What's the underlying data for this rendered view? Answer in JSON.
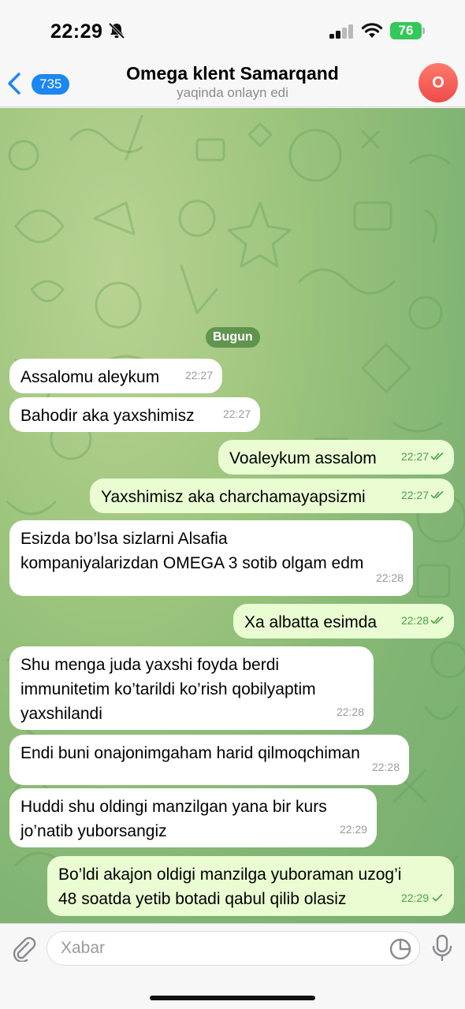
{
  "status": {
    "time": "22:29",
    "battery": "76"
  },
  "header": {
    "back_count": "735",
    "title": "Omega klent Samarqand",
    "subtitle": "yaqinda onlayn edi",
    "avatar_letter": "O"
  },
  "date_label": "Bugun",
  "messages": [
    {
      "dir": "in",
      "text": "Assalomu aleykum",
      "time": "22:27"
    },
    {
      "dir": "in",
      "text": "Bahodir aka yaxshimisz",
      "time": "22:27"
    },
    {
      "dir": "out",
      "text": "Voaleykum assalom",
      "time": "22:27",
      "status": "read"
    },
    {
      "dir": "out",
      "text": "Yaxshimisz aka charchamayapsizmi",
      "time": "22:27",
      "status": "read"
    },
    {
      "dir": "in",
      "text": "Esizda bo’lsa sizlarni Alsafia\nkompaniyalarizdan OMEGA 3 sotib olgam edm",
      "time": "22:28"
    },
    {
      "dir": "out",
      "text": "Xa albatta esimda",
      "time": "22:28",
      "status": "read"
    },
    {
      "dir": "in",
      "text": "Shu menga juda yaxshi foyda berdi\nimmunitetim ko’tarildi ko’rish qobilyaptim\nyaxshilandi",
      "time": "22:28"
    },
    {
      "dir": "in",
      "text": "Endi buni onajonimgaham harid qilmoqchiman",
      "time": "22:28"
    },
    {
      "dir": "in",
      "text": "Huddi shu oldingi manzilgan yana bir kurs\njo’natib yuborsangiz",
      "time": "22:29"
    },
    {
      "dir": "out",
      "text": "Bo’ldi akajon oldigi manzilga yuboraman uzog’i\n48 soatda yetib botadi qabul qilib olasiz",
      "time": "22:29",
      "status": "sent"
    }
  ],
  "input": {
    "placeholder": "Xabar"
  },
  "colors": {
    "accent": "#1c86f2",
    "incoming": "#ffffff",
    "outgoing": "#e9fcd2",
    "check": "#4aa248",
    "wallpaper": "#9dc57d"
  },
  "icons": [
    "bell-muted-icon",
    "signal-icon",
    "wifi-icon",
    "battery-icon",
    "back-chevron-icon",
    "double-check-icon",
    "single-check-icon",
    "attach-icon",
    "sticker-icon",
    "mic-icon"
  ]
}
